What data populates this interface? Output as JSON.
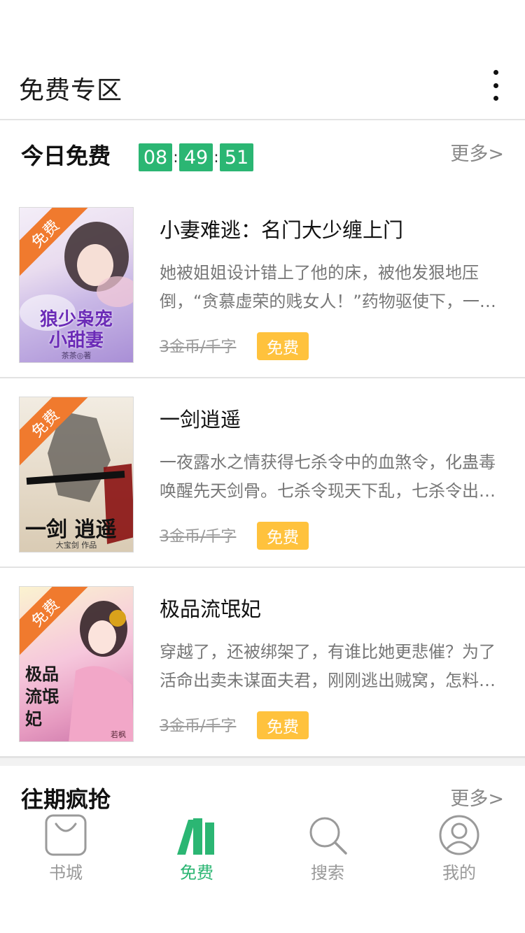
{
  "header": {
    "title": "免费专区"
  },
  "today_free": {
    "title": "今日免费",
    "timer": {
      "hours": "08",
      "minutes": "49",
      "seconds": "51",
      "separator": ":"
    },
    "more_label": "更多>"
  },
  "books": [
    {
      "ribbon": "免费",
      "title": "小妻难逃：名门大少缠上门",
      "description": "她被姐姐设计错上了他的床，被他发狠地压倒，“贪慕虚荣的贱女人！”药物驱使下，一夜缠绵，他几乎要了她的命……",
      "old_price": "3金币/千字",
      "free_tag": "免费",
      "cover_title": "狼少枭宠\n小甜妻",
      "cover_sub": "茶茶◎著"
    },
    {
      "ribbon": "免费",
      "title": "一剑逍遥",
      "description": "一夜露水之情获得七杀令中的血煞令，化蛊毒唤醒先天剑骨。七杀令现天下乱，七杀令出谁与争锋……",
      "old_price": "3金币/千字",
      "free_tag": "免费",
      "cover_title": "一剑 逍遥",
      "cover_sub": "大宝剑 作品"
    },
    {
      "ribbon": "免费",
      "title": "极品流氓妃",
      "description": "穿越了，还被绑架了，有谁比她更悲催？为了活命出卖未谋面夫君，刚刚逃出贼窝，怎料又入狼窝……",
      "old_price": "3金币/千字",
      "free_tag": "免费",
      "cover_title": "极品流氓妃",
      "cover_sub": "若枫"
    }
  ],
  "past_section": {
    "title": "往期疯抢",
    "more_label": "更多>"
  },
  "bottom_nav": [
    {
      "label": "书城",
      "icon": "bag-icon",
      "active": false
    },
    {
      "label": "免费",
      "icon": "books-icon",
      "active": true
    },
    {
      "label": "搜索",
      "icon": "search-icon",
      "active": false
    },
    {
      "label": "我的",
      "icon": "user-icon",
      "active": false
    }
  ],
  "colors": {
    "accent_green": "#2bb673",
    "ribbon_orange": "#f07a2e",
    "free_tag_yellow": "#ffc23d"
  }
}
